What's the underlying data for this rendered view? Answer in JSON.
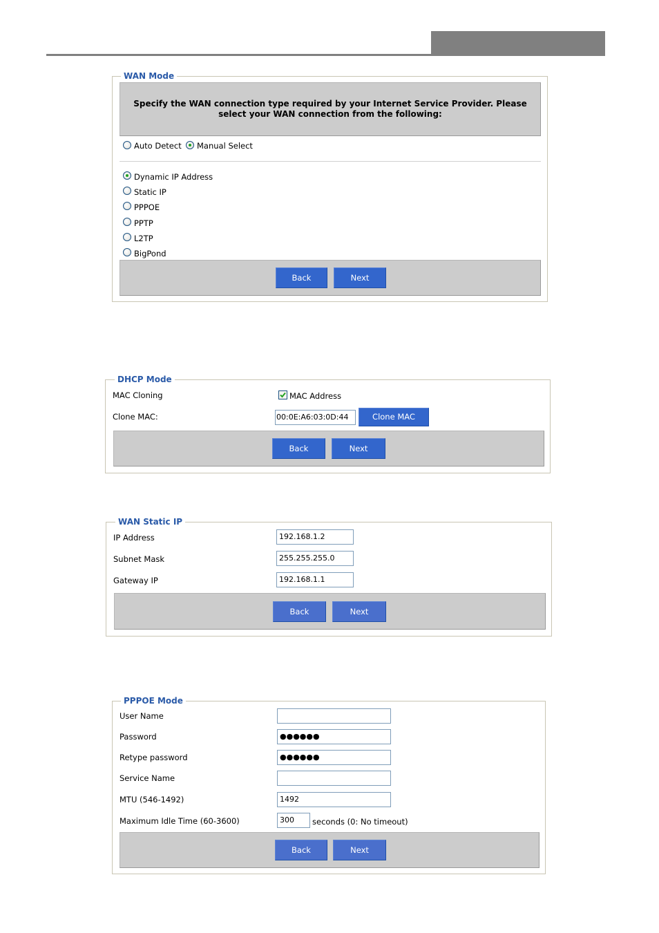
{
  "wan_mode": {
    "legend": "WAN Mode",
    "description_line1": "Specify the WAN connection type required by your Internet Service Provider. Please",
    "description_line2": "select your WAN connection from the following:",
    "detect_options": [
      {
        "label": "Auto Detect",
        "selected": false
      },
      {
        "label": "Manual Select",
        "selected": true
      }
    ],
    "connection_types": [
      {
        "label": "Dynamic IP Address",
        "selected": true
      },
      {
        "label": "Static IP",
        "selected": false
      },
      {
        "label": "PPPOE",
        "selected": false
      },
      {
        "label": "PPTP",
        "selected": false
      },
      {
        "label": "L2TP",
        "selected": false
      },
      {
        "label": "BigPond",
        "selected": false
      }
    ],
    "back_label": "Back",
    "next_label": "Next"
  },
  "dhcp_mode": {
    "legend": "DHCP Mode",
    "mac_cloning_label": "MAC Cloning",
    "mac_address_checkbox_label": "MAC Address",
    "mac_address_checked": true,
    "clone_mac_label": "Clone MAC:",
    "clone_mac_value": "00:0E:A6:03:0D:44",
    "clone_mac_button": "Clone MAC",
    "back_label": "Back",
    "next_label": "Next"
  },
  "wan_static_ip": {
    "legend": "WAN Static IP",
    "fields": [
      {
        "label": "IP Address",
        "value": "192.168.1.2"
      },
      {
        "label": "Subnet Mask",
        "value": "255.255.255.0"
      },
      {
        "label": "Gateway IP",
        "value": "192.168.1.1"
      }
    ],
    "back_label": "Back",
    "next_label": "Next"
  },
  "pppoe_mode": {
    "legend": "PPPOE Mode",
    "fields": [
      {
        "label": "User Name",
        "value": ""
      },
      {
        "label": "Password",
        "value": "●●●●●●"
      },
      {
        "label": "Retype password",
        "value": "●●●●●●"
      },
      {
        "label": "Service Name",
        "value": ""
      },
      {
        "label": "MTU (546-1492)",
        "value": "1492"
      },
      {
        "label": "Maximum Idle Time (60-3600)",
        "value": "300"
      }
    ],
    "idle_time_suffix": "seconds (0: No timeout)",
    "back_label": "Back",
    "next_label": "Next"
  },
  "colors": {
    "button_blue": "#3366cc",
    "button_blue_light": "#4a6fcc",
    "legend_blue": "#2a5aa8",
    "panel_gray": "#cccccc",
    "radio_selected_dot": "#21a121"
  }
}
